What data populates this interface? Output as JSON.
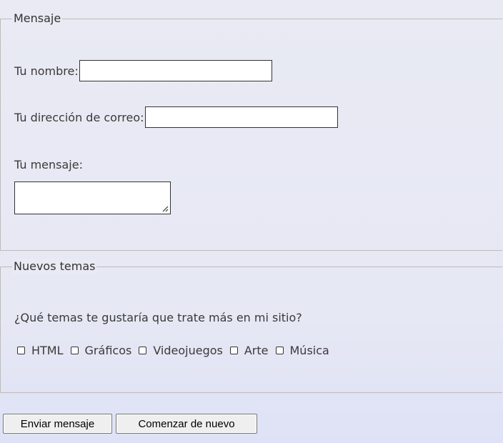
{
  "mensaje": {
    "legend": "Mensaje",
    "name_label": "Tu nombre:",
    "name_value": "",
    "email_label": "Tu dirección de correo:",
    "email_value": "",
    "message_label": "Tu mensaje:",
    "message_value": ""
  },
  "temas": {
    "legend": "Nuevos temas",
    "question": "¿Qué temas te gustaría que trate más en mi sitio?",
    "options": [
      "HTML",
      "Gráficos",
      "Videojuegos",
      "Arte",
      "Música"
    ]
  },
  "buttons": {
    "send_label": "Enviar mensaje",
    "reset_label": "Comenzar de nuevo"
  }
}
